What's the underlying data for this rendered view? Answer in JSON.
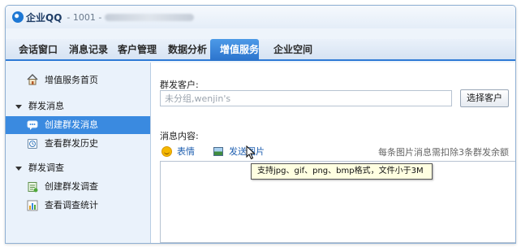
{
  "window": {
    "app_name": "企业QQ",
    "app_id": "- 1001 -"
  },
  "tabs": [
    {
      "label": "会话窗口",
      "active": false
    },
    {
      "label": "消息记录",
      "active": false
    },
    {
      "label": "客户管理",
      "active": false
    },
    {
      "label": "数据分析",
      "active": false
    },
    {
      "label": "增值服务",
      "active": true
    },
    {
      "label": "企业空间",
      "active": false
    }
  ],
  "sidebar": {
    "home_label": "增值服务首页",
    "sections": [
      {
        "title": "群发消息",
        "items": [
          {
            "label": "创建群发消息",
            "icon": "chat-bubble-icon",
            "active": true
          },
          {
            "label": "查看群发历史",
            "icon": "history-icon",
            "active": false
          }
        ]
      },
      {
        "title": "群发调查",
        "items": [
          {
            "label": "创建群发调查",
            "icon": "survey-icon",
            "active": false
          },
          {
            "label": "查看调查统计",
            "icon": "bar-chart-icon",
            "active": false
          }
        ]
      }
    ]
  },
  "main": {
    "recipients_label": "群发客户:",
    "recipients_value": "未分组,wenjin's",
    "select_button": "选择客户",
    "message_label": "消息内容:",
    "emoji_label": "表情",
    "send_image_label": "发送图片",
    "hint_text": "每条图片消息需扣除3条群发余额",
    "tooltip": "支持jpg、gif、png、bmp格式，文件小于3M"
  },
  "colors": {
    "accent": "#2e7ad6",
    "active_item": "#3a8ae0",
    "tooltip_bg": "#ffffe1"
  }
}
